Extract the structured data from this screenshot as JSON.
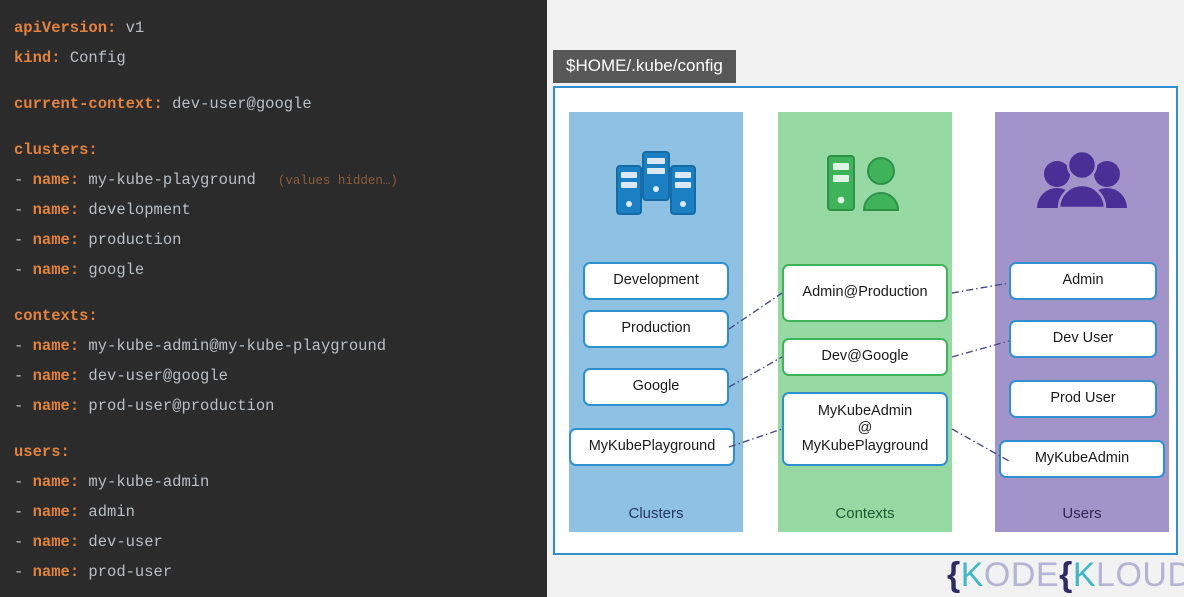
{
  "terminal": {
    "lines": [
      {
        "key": "apiVersion:",
        "value": " v1",
        "dash": false
      },
      {
        "key": "kind:",
        "value": " Config",
        "dash": false
      },
      {
        "gap": true
      },
      {
        "key": "current-context:",
        "value": " dev-user@google",
        "dash": false
      },
      {
        "gap": true
      },
      {
        "key": "clusters:",
        "value": "",
        "dash": false
      },
      {
        "key": "name:",
        "value": " my-kube-playground",
        "dash": true,
        "note": "(values hidden…)"
      },
      {
        "key": "name:",
        "value": " development",
        "dash": true
      },
      {
        "key": "name:",
        "value": " production",
        "dash": true
      },
      {
        "key": "name:",
        "value": " google",
        "dash": true
      },
      {
        "gap": true
      },
      {
        "key": "contexts:",
        "value": "",
        "dash": false
      },
      {
        "key": "name:",
        "value": " my-kube-admin@my-kube-playground",
        "dash": true
      },
      {
        "key": "name:",
        "value": " dev-user@google",
        "dash": true
      },
      {
        "key": "name:",
        "value": " prod-user@production",
        "dash": true
      },
      {
        "gap": true
      },
      {
        "key": "users:",
        "value": "",
        "dash": false
      },
      {
        "key": "name:",
        "value": " my-kube-admin",
        "dash": true
      },
      {
        "key": "name:",
        "value": " admin",
        "dash": true
      },
      {
        "key": "name:",
        "value": " dev-user",
        "dash": true
      },
      {
        "key": "name:",
        "value": " prod-user",
        "dash": true
      }
    ],
    "colors": {
      "background": "#2b2b2b",
      "key": "#e2833d",
      "value": "#b9bfc4",
      "note": "#8a5c3a"
    }
  },
  "diagram": {
    "file_tag": "$HOME/.kube/config",
    "frame_border_color": "#2f90cf",
    "columns": [
      {
        "id": "clusters",
        "label": "Clusters",
        "icon": "servers-icon",
        "background": "#8fc1e3",
        "accent": "#1b7fc4",
        "items": [
          "Development",
          "Production",
          "Google",
          "MyKubePlayground"
        ]
      },
      {
        "id": "contexts",
        "label": "Contexts",
        "icon": "server-and-user-icon",
        "background": "#97d9a3",
        "accent": "#3eb35a",
        "items": [
          "Admin@Production",
          "Dev@Google",
          "MyKubeAdmin\n@\nMyKubePlayground"
        ]
      },
      {
        "id": "users",
        "label": "Users",
        "icon": "group-of-users-icon",
        "background": "#a294c9",
        "accent": "#4a2f97",
        "items": [
          "Admin",
          "Dev User",
          "Prod User",
          "MyKubeAdmin"
        ]
      }
    ],
    "connections": [
      {
        "from": "Production",
        "to": "Admin@Production"
      },
      {
        "from": "Google",
        "to": "Dev@Google"
      },
      {
        "from": "MyKubePlayground",
        "to": "MyKubeAdmin@MyKubePlayground"
      },
      {
        "from": "Admin@Production",
        "to": "Admin"
      },
      {
        "from": "Dev@Google",
        "to": "Dev User"
      },
      {
        "from": "MyKubeAdmin@MyKubePlayground",
        "to": "MyKubeAdmin"
      }
    ]
  },
  "logo": {
    "brace1": "{",
    "k1": "K",
    "part1": "ODE",
    "brace2": "{",
    "k2": "K",
    "part2": "LOUD"
  }
}
